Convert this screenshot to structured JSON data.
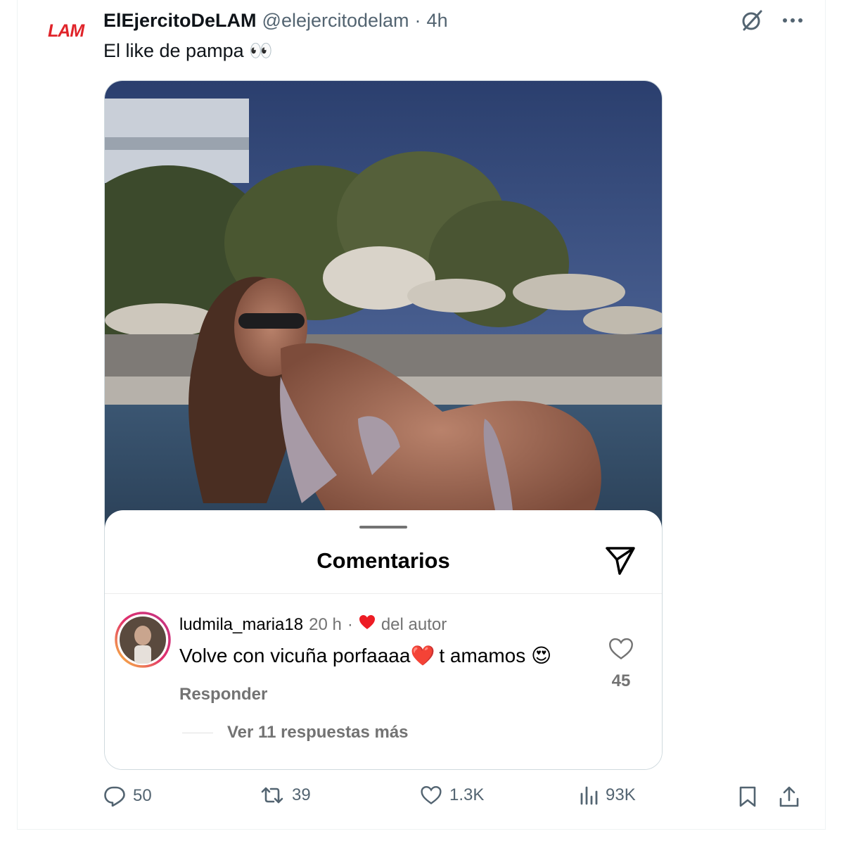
{
  "post": {
    "avatar_text": "LAM",
    "display_name": "ElEjercitoDeLAM",
    "handle": "@elejercitodelam",
    "separator": "·",
    "time": "4h",
    "text": "El like de pampa 👀",
    "top_icons": [
      "grok-icon",
      "more-icon"
    ]
  },
  "embedded": {
    "sheet_title": "Comentarios",
    "comment": {
      "username": "ludmila_maria18",
      "time": "20 h",
      "separator": "·",
      "author_like_label": "del autor",
      "text_before": "Volve con vicuña porfaaaa❤️",
      "text_after": "t amamos 😍",
      "reply_label": "Responder",
      "like_count": "45"
    },
    "more_replies_label": "Ver 11 respuestas más"
  },
  "actions": {
    "replies": "50",
    "reposts": "39",
    "likes": "1.3K",
    "views": "93K"
  },
  "colors": {
    "accent_red": "#e0242a",
    "text_primary": "#0f1419",
    "text_secondary": "#536471",
    "ig_secondary": "#737373",
    "heart_red": "#ed1c24"
  }
}
